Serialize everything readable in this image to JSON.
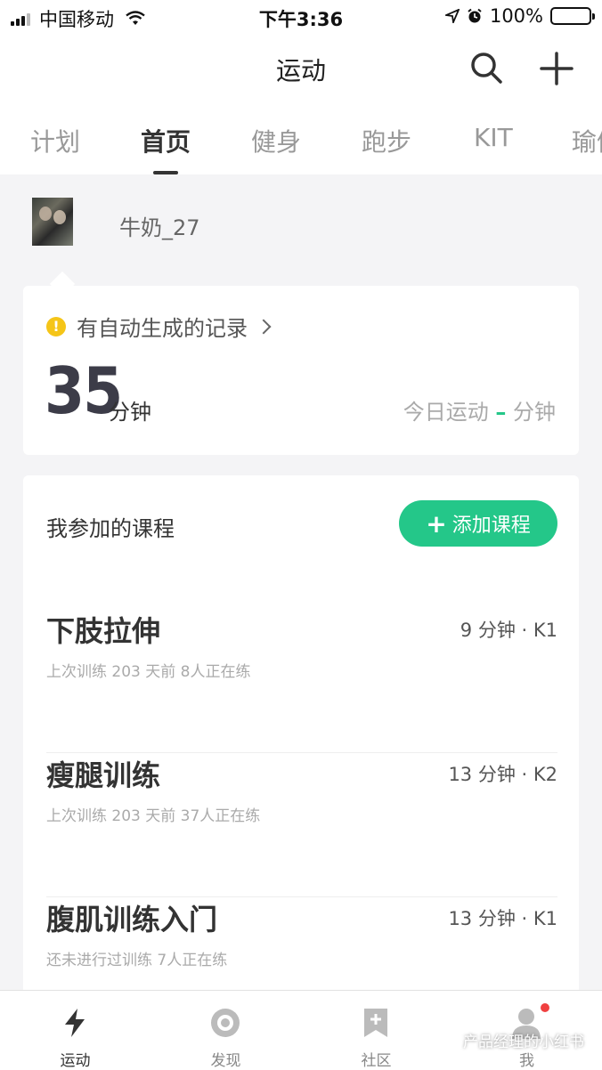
{
  "status_bar": {
    "carrier": "中国移动",
    "time": "下午3:36",
    "battery": "100%",
    "icons": [
      "signal-icon",
      "wifi-icon",
      "location-icon",
      "alarm-icon",
      "battery-icon"
    ]
  },
  "nav": {
    "title": "运动",
    "icons": [
      "search-icon",
      "add-icon"
    ]
  },
  "tabs": {
    "items": [
      {
        "label": "计划"
      },
      {
        "label": "首页"
      },
      {
        "label": "健身"
      },
      {
        "label": "跑步"
      },
      {
        "label": "KIT"
      },
      {
        "label": "瑜伽"
      }
    ],
    "active": "首页"
  },
  "profile": {
    "username": "牛奶_27"
  },
  "record_card": {
    "notice": "有自动生成的记录",
    "minutes": "35",
    "unit": "分钟",
    "today_label": "今日运动",
    "today_value": "–",
    "today_unit": "分钟",
    "colors": {
      "warn": "#f5c518",
      "accent": "#24c789"
    }
  },
  "courses": {
    "title": "我参加的课程",
    "add_button": "添加课程",
    "items": [
      {
        "name": "下肢拉伸",
        "meta": "9 分钟 · K1",
        "sub": "上次训练 203 天前  8人正在练"
      },
      {
        "name": "瘦腿训练",
        "meta": "13 分钟 · K2",
        "sub": "上次训练 203 天前  37人正在练"
      },
      {
        "name": "腹肌训练入门",
        "meta": "13 分钟 · K1",
        "sub": "还未进行过训练  7人正在练"
      }
    ]
  },
  "tabbar": {
    "items": [
      {
        "label": "运动",
        "icon": "lightning-icon"
      },
      {
        "label": "发现",
        "icon": "discover-icon"
      },
      {
        "label": "社区",
        "icon": "community-icon"
      },
      {
        "label": "我",
        "icon": "profile-icon"
      }
    ],
    "active": "运动"
  },
  "watermark": "产品经理的小红书"
}
